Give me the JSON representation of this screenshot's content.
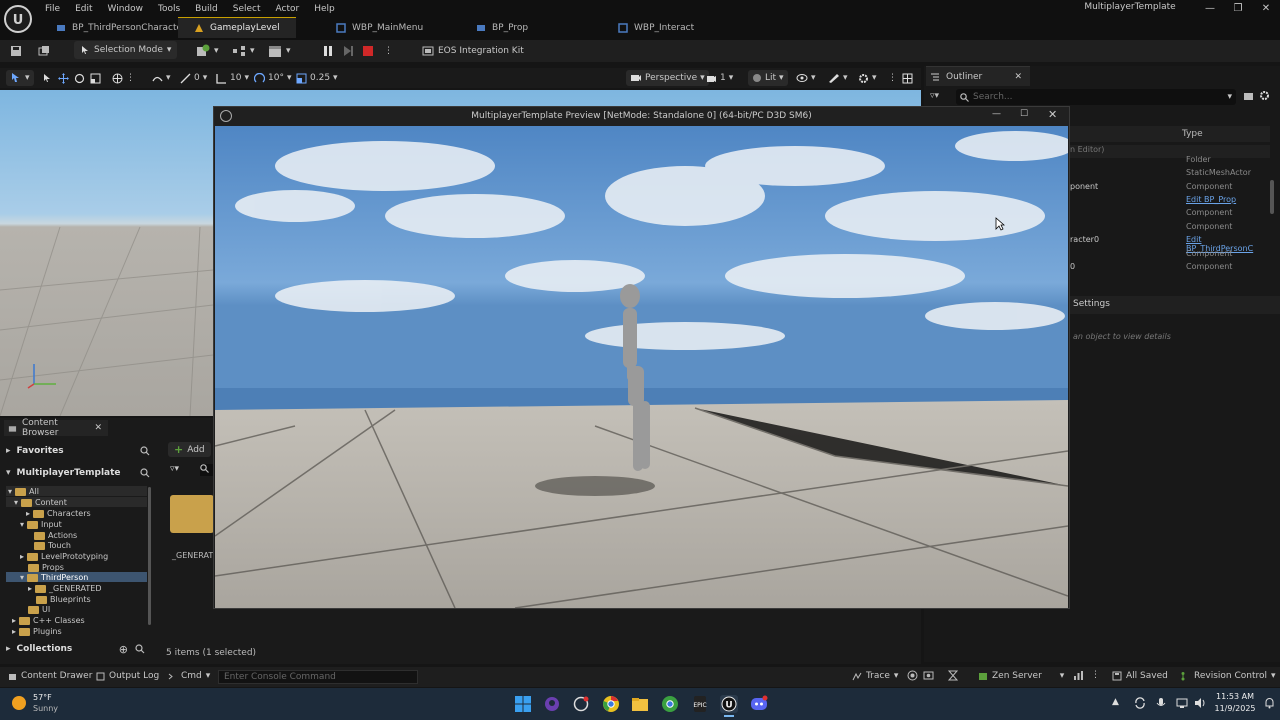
{
  "menu": [
    "File",
    "Edit",
    "Window",
    "Tools",
    "Build",
    "Select",
    "Actor",
    "Help"
  ],
  "app_title": "MultiplayerTemplate",
  "tabs": [
    {
      "label": "BP_ThirdPersonCharacter",
      "active": false
    },
    {
      "label": "GameplayLevel",
      "active": true
    },
    {
      "label": "WBP_MainMenu",
      "active": false
    },
    {
      "label": "BP_Prop",
      "active": false
    },
    {
      "label": "WBP_Interact",
      "active": false
    }
  ],
  "toolbar": {
    "selection_mode": "Selection Mode",
    "eos": "EOS Integration Kit"
  },
  "viewport_toolbar": {
    "rotate_snap": "0",
    "grid_snap": "10",
    "angle_snap": "10°",
    "scale_snap": "0.25",
    "perspective": "Perspective",
    "camera_speed": "1",
    "lit": "Lit"
  },
  "outliner": {
    "tab": "Outliner",
    "search_placeholder": "Search...",
    "type_header": "Type",
    "rows": [
      {
        "name": "n Editor)",
        "type": ""
      },
      {
        "name": "",
        "type": "Folder"
      },
      {
        "name": "",
        "type": "StaticMeshActor"
      },
      {
        "name": "ponent",
        "type": "Component"
      },
      {
        "name": "",
        "type": "Edit BP_Prop",
        "link": true
      },
      {
        "name": "",
        "type": "Component"
      },
      {
        "name": "",
        "type": "Component"
      },
      {
        "name": "racter0",
        "type": "Edit BP_ThirdPersonC",
        "link": true
      },
      {
        "name": "0",
        "type": "Component"
      },
      {
        "name": "",
        "type": "Component"
      }
    ],
    "details_label": "Settings",
    "details_hint": "an object to view details"
  },
  "content_browser": {
    "tab": "Content Browser",
    "favorites": "Favorites",
    "project": "MultiplayerTemplate",
    "add": "Add",
    "tree": [
      {
        "label": "All",
        "depth": 0
      },
      {
        "label": "Content",
        "depth": 1
      },
      {
        "label": "Characters",
        "depth": 2
      },
      {
        "label": "Input",
        "depth": 2
      },
      {
        "label": "Actions",
        "depth": 3
      },
      {
        "label": "Touch",
        "depth": 3
      },
      {
        "label": "LevelPrototyping",
        "depth": 2
      },
      {
        "label": "Props",
        "depth": 2
      },
      {
        "label": "ThirdPerson",
        "depth": 2
      },
      {
        "label": "_GENERATED",
        "depth": 3
      },
      {
        "label": "Blueprints",
        "depth": 3
      },
      {
        "label": "UI",
        "depth": 2
      },
      {
        "label": "C++ Classes",
        "depth": 1
      },
      {
        "label": "Plugins",
        "depth": 1
      }
    ],
    "folder_asset": "_GENERATI",
    "item_count": "5 items (1 selected)",
    "collections": "Collections"
  },
  "preview": {
    "title": "MultiplayerTemplate Preview [NetMode: Standalone 0]  (64-bit/PC D3D SM6)"
  },
  "statusbar": {
    "content_drawer": "Content Drawer",
    "output_log": "Output Log",
    "cmd": "Cmd",
    "console_placeholder": "Enter Console Command",
    "trace": "Trace",
    "zen_server": "Zen Server",
    "all_saved": "All Saved",
    "revision_control": "Revision Control"
  },
  "taskbar": {
    "temp": "57°F",
    "weather": "Sunny",
    "time": "11:53 AM",
    "date": "11/9/2025"
  }
}
